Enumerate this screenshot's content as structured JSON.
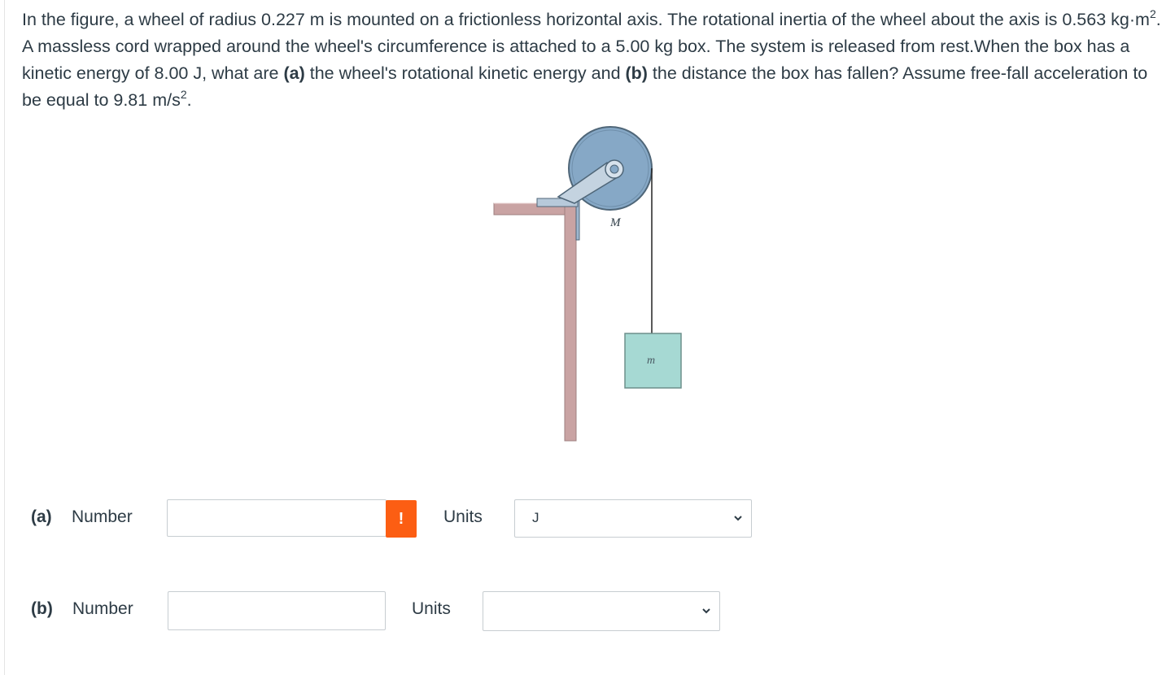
{
  "question": {
    "part1": "In the figure, a wheel of radius 0.227 m is mounted on a frictionless horizontal axis. The rotational inertia of the wheel about the axis is 0.563 kg·m",
    "sup1": "2",
    "part2": ". A massless cord wrapped around the wheel's circumference is attached to a 5.00 kg box. The system is released from rest.When the box has a kinetic energy of 8.00 J, what are ",
    "bold_a": "(a)",
    "part3": " the wheel's rotational kinetic energy and ",
    "bold_b": "(b)",
    "part4": " the distance the box has fallen? Assume free-fall acceleration to be equal to 9.81 m/s",
    "sup2": "2",
    "part5": "."
  },
  "figure": {
    "wheel_label": "M",
    "box_label": "m"
  },
  "answers": [
    {
      "part_label": "(a)",
      "number_label": "Number",
      "value": "",
      "warning_glyph": "!",
      "units_label": "Units",
      "units_value": "J"
    },
    {
      "part_label": "(b)",
      "number_label": "Number",
      "value": "",
      "units_label": "Units",
      "units_value": ""
    }
  ],
  "colors": {
    "text": "#2d3b45",
    "warning": "#fc5e13",
    "input_border": "#c7cdd1",
    "wheel": "#86a8c6",
    "support": "#c9a3a3",
    "box": "#a6d9d3"
  }
}
